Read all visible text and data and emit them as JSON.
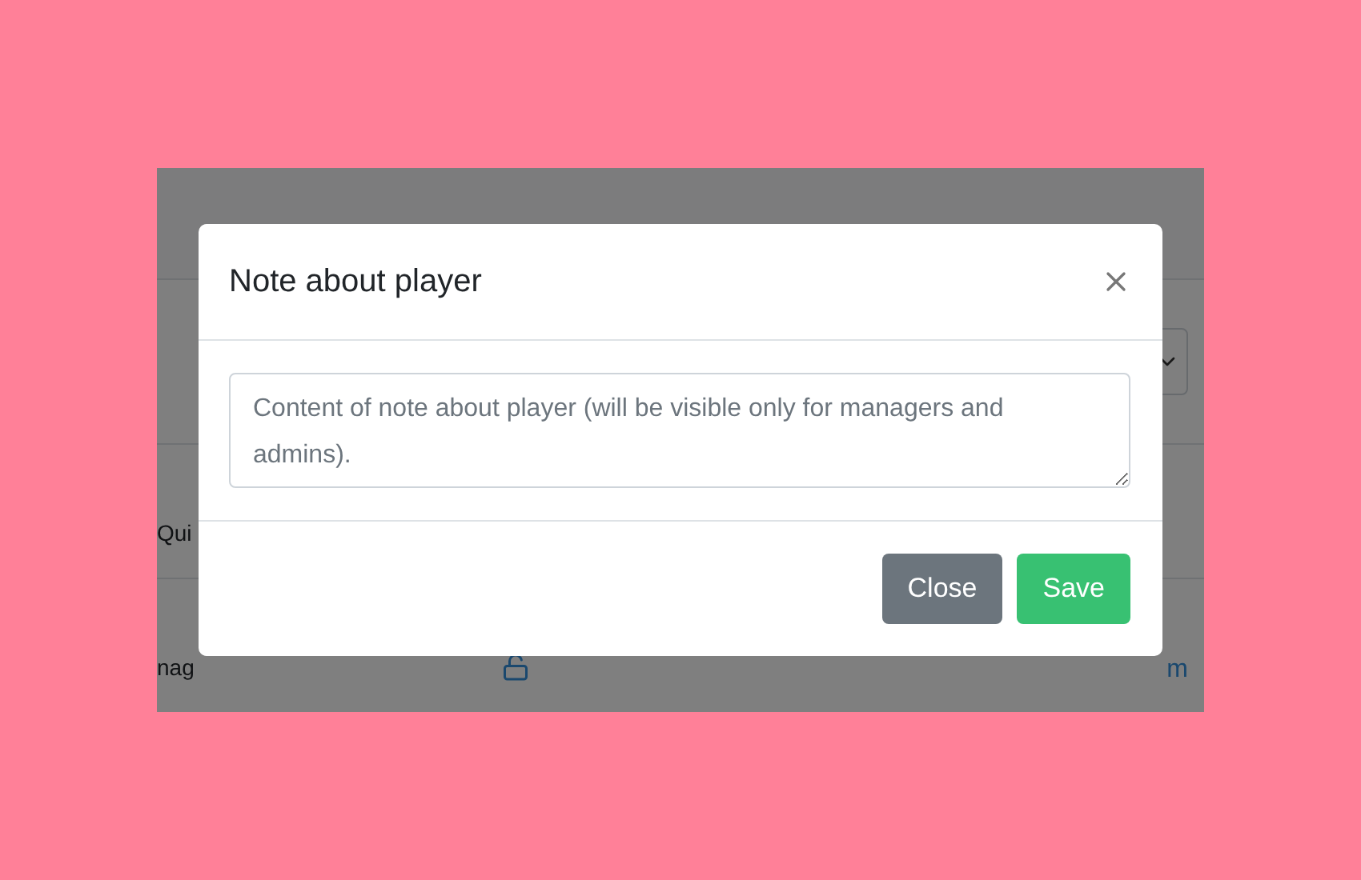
{
  "background_page": {
    "rows": [
      {
        "text": "Qui"
      },
      {
        "text": "nag",
        "link": "m"
      }
    ]
  },
  "modal": {
    "title": "Note about player",
    "note_field": {
      "placeholder": "Content of note about player (will be visible only for managers and admins)."
    },
    "buttons": [
      {
        "label": "Close",
        "kind": "secondary"
      },
      {
        "label": "Save",
        "kind": "primary"
      }
    ]
  }
}
